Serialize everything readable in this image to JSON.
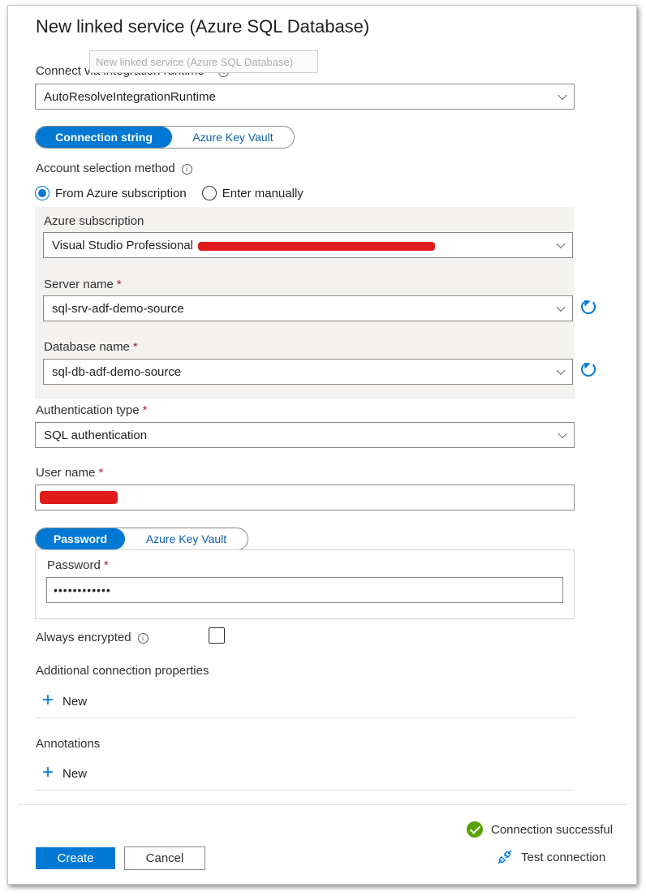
{
  "dialog": {
    "title": "New linked service (Azure SQL Database)",
    "tooltip": "New linked service (Azure SQL Database)"
  },
  "runtime": {
    "label": "Connect via integration runtime",
    "required": "*",
    "value": "AutoResolveIntegrationRuntime"
  },
  "connection_toggle": {
    "active": "Connection string",
    "inactive": "Azure Key Vault"
  },
  "account_selection": {
    "label": "Account selection method",
    "options": [
      "From Azure subscription",
      "Enter manually"
    ],
    "selected": "From Azure subscription"
  },
  "subscription": {
    "label": "Azure subscription",
    "value_prefix": "Visual Studio Professional"
  },
  "server": {
    "label": "Server name",
    "required": "*",
    "value": "sql-srv-adf-demo-source"
  },
  "database": {
    "label": "Database name",
    "required": "*",
    "value": "sql-db-adf-demo-source"
  },
  "auth": {
    "label": "Authentication type",
    "required": "*",
    "value": "SQL authentication"
  },
  "username": {
    "label": "User name",
    "required": "*"
  },
  "password_toggle": {
    "active": "Password",
    "inactive": "Azure Key Vault"
  },
  "password": {
    "label": "Password",
    "required": "*",
    "value": "••••••••••••"
  },
  "always_encrypted": {
    "label": "Always encrypted"
  },
  "additional_props": {
    "label": "Additional connection properties",
    "new_label": "New"
  },
  "annotations": {
    "label": "Annotations",
    "new_label": "New"
  },
  "status": {
    "text": "Connection successful",
    "color": "#57a300"
  },
  "footer": {
    "create": "Create",
    "cancel": "Cancel",
    "test": "Test connection"
  },
  "colors": {
    "accent": "#0078d4",
    "required": "#a4262c",
    "redaction": "#e01b1b"
  },
  "info_icon_glyph": "i"
}
